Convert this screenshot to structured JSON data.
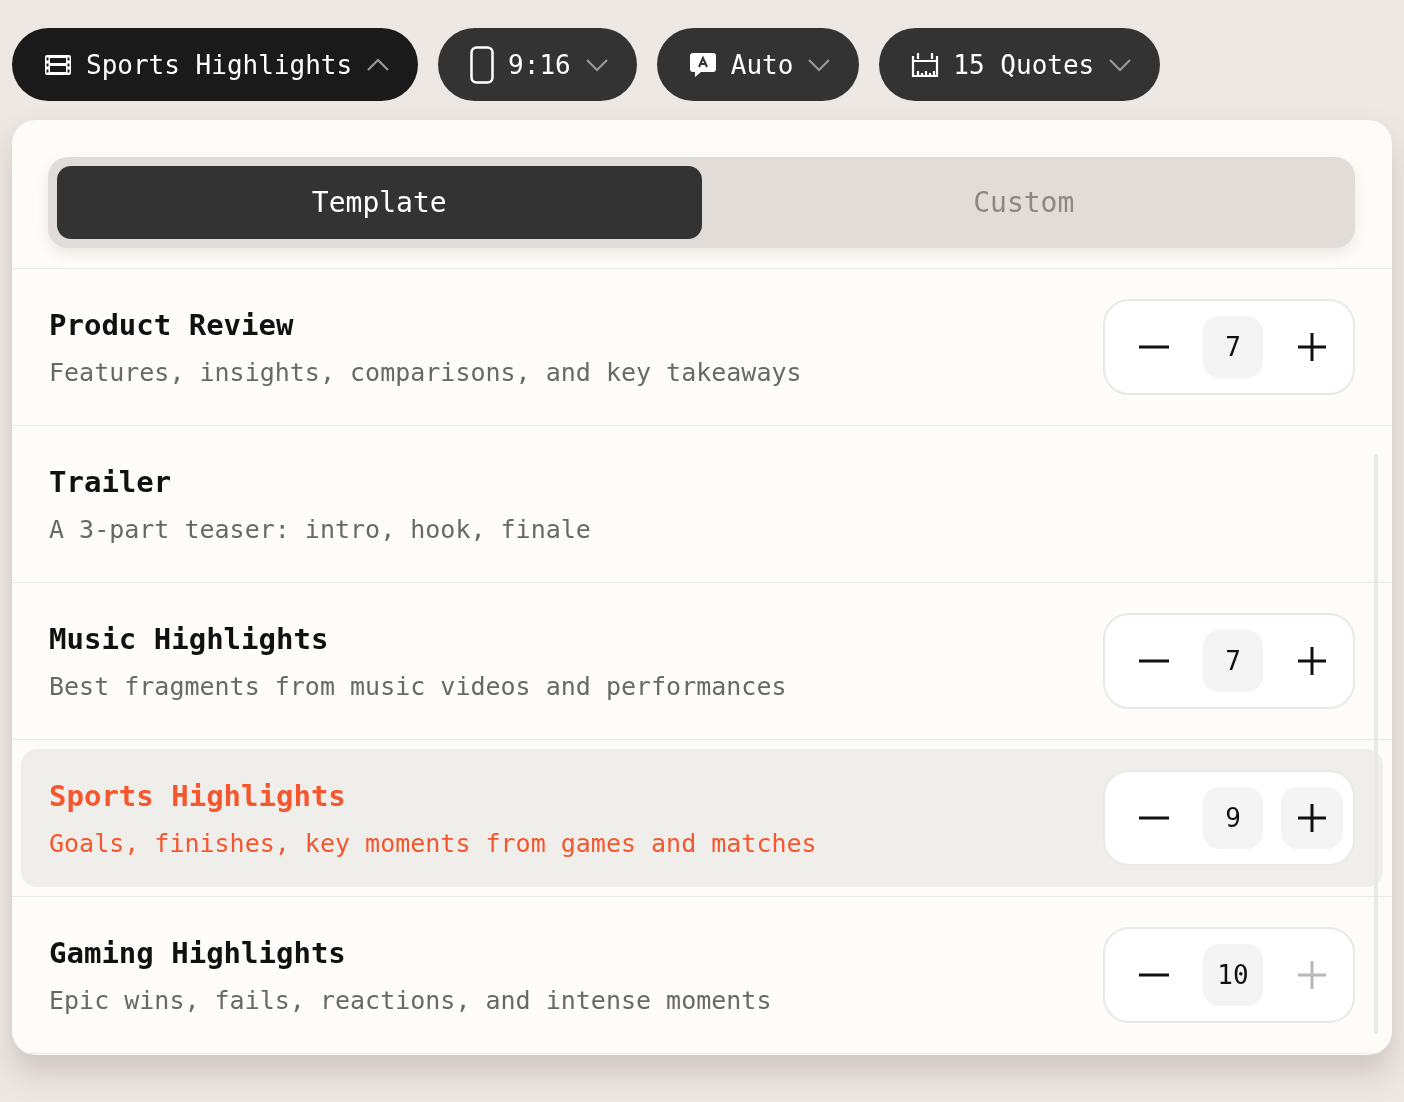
{
  "toolbar": [
    {
      "kind": "template",
      "label": "Sports Highlights",
      "expanded": true
    },
    {
      "kind": "ratio",
      "label": "9:16",
      "expanded": false
    },
    {
      "kind": "captions",
      "label": "Auto",
      "expanded": false
    },
    {
      "kind": "count",
      "label": "15 Quotes",
      "expanded": false
    }
  ],
  "mode_tabs": [
    {
      "label": "Template",
      "selected": true
    },
    {
      "label": "Custom",
      "selected": false
    }
  ],
  "templates": [
    {
      "title": "Product Review",
      "description": "Features, insights, comparisons, and key takeaways",
      "selected": false,
      "count": "7",
      "plus_disabled": false
    },
    {
      "title": "Trailer",
      "description": "A 3-part teaser: intro, hook, finale",
      "selected": false
    },
    {
      "title": "Music Highlights",
      "description": "Best fragments from music videos and performances",
      "selected": false,
      "count": "7",
      "plus_disabled": false
    },
    {
      "title": "Sports Highlights",
      "description": "Goals, finishes, key moments from games and matches",
      "selected": true,
      "count": "9",
      "plus_disabled": false
    },
    {
      "title": "Gaming Highlights",
      "description": "Epic wins, fails, reactions, and intense moments",
      "selected": false,
      "count": "10",
      "plus_disabled": true
    }
  ]
}
